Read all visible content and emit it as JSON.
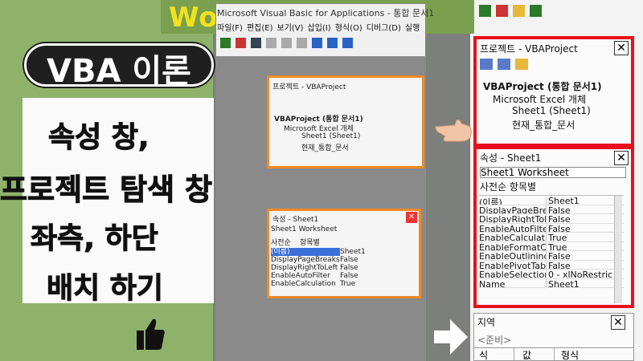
{
  "banner": {
    "text": "Wo          ncel"
  },
  "left": {
    "title": "VBA 이론",
    "lines": [
      "속성 창,",
      "프로젝트 탐색 창",
      "좌측, 하단",
      "배치 하기"
    ]
  },
  "vbe": {
    "title": "Microsoft Visual Basic for Applications - 통합 문서1",
    "menu": [
      "파일(F)",
      "편집(E)",
      "보기(V)",
      "삽입(I)",
      "형식(O)",
      "디버그(D)",
      "실행"
    ],
    "project": {
      "title": "프로젝트 - VBAProject",
      "root": "VBAProject (통합 문서1)",
      "folder": "Microsoft Excel 개체",
      "sheet": "Sheet1 (Sheet1)",
      "workbook": "현재_통합_문서"
    },
    "properties": {
      "title": "속성 - Sheet1",
      "object": "Sheet1 Worksheet",
      "tabs": [
        "사전순",
        "항목별"
      ],
      "rows": [
        [
          "(이름)",
          "Sheet1"
        ],
        [
          "DisplayPageBreaks",
          "False"
        ],
        [
          "DisplayRightToLeft",
          "False"
        ],
        [
          "EnableAutoFilter",
          "False"
        ],
        [
          "EnableCalculation",
          "True"
        ]
      ]
    }
  },
  "right": {
    "project": {
      "title": "프로젝트 - VBAProject",
      "root": "VBAProject (통합 문서1)",
      "folder": "Microsoft Excel 개체",
      "sheet": "Sheet1 (Sheet1)",
      "workbook": "현재_통합_문서"
    },
    "properties": {
      "title": "속성 - Sheet1",
      "object": "Sheet1 Worksheet",
      "tabs": "사전순 항목별",
      "rows": [
        [
          "(이름)",
          "Sheet1"
        ],
        [
          "DisplayPageBre",
          "False"
        ],
        [
          "DisplayRightToL",
          "False"
        ],
        [
          "EnableAutoFilter",
          "False"
        ],
        [
          "EnableCalculatic",
          "True"
        ],
        [
          "EnableFormatCo",
          "True"
        ],
        [
          "EnableOutlining",
          "False"
        ],
        [
          "EnablePivotTabl",
          "False"
        ],
        [
          "EnableSelection",
          "0 - xlNoRestric"
        ],
        [
          "Name",
          "Sheet1"
        ]
      ]
    },
    "locals": {
      "title": "지역",
      "value": "<준비>",
      "columns": [
        "식",
        "값",
        "형식"
      ]
    }
  },
  "colors": {
    "accent": "#e8101a",
    "highlight": "#f08a24",
    "banner_text": "#f3e21b"
  }
}
